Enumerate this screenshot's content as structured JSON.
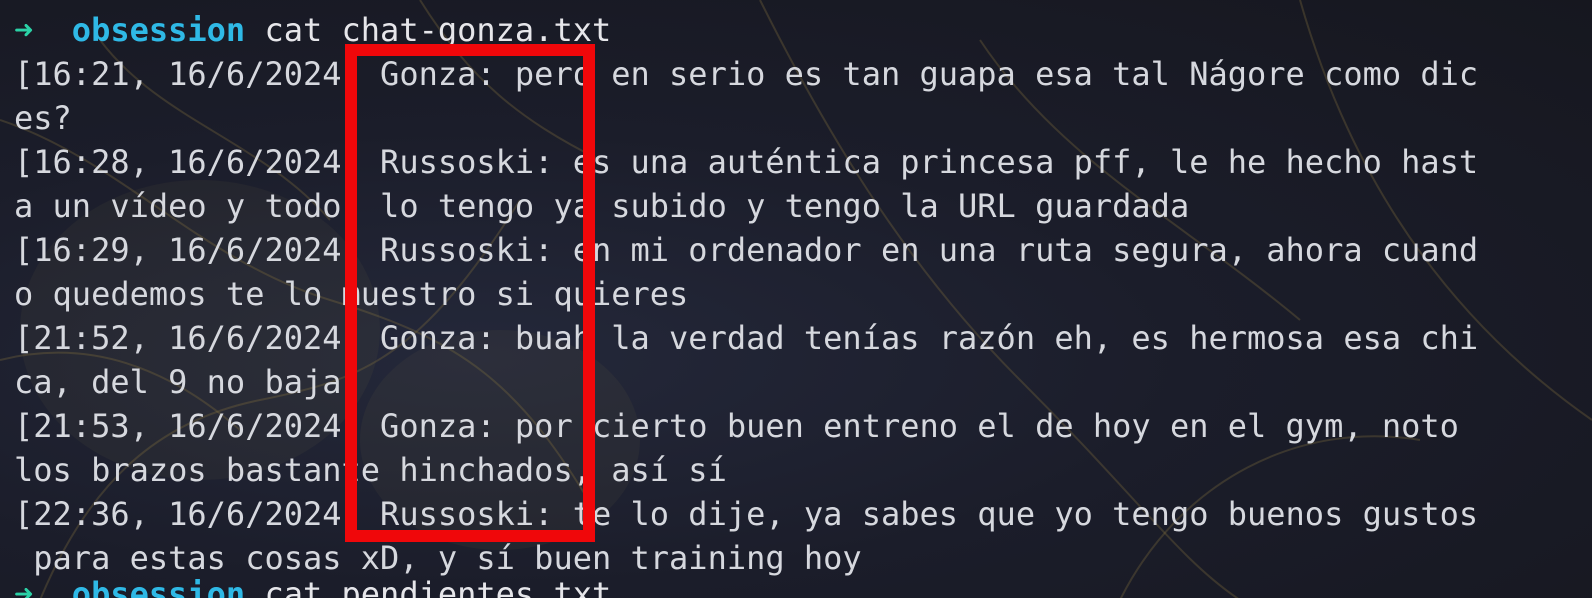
{
  "terminal": {
    "prompt_arrow": "➜",
    "prompt_dir": "obsession",
    "command": "cat chat-gonza.txt",
    "lines": [
      "[16:21, 16/6/2024] Gonza: pero en serio es tan guapa esa tal Nágore como dic",
      "es?",
      "[16:28, 16/6/2024] Russoski: es una auténtica princesa pff, le he hecho hast",
      "a un vídeo y todo, lo tengo ya subido y tengo la URL guardada",
      "[16:29, 16/6/2024] Russoski: en mi ordenador en una ruta segura, ahora cuand",
      "o quedemos te lo muestro si quieres",
      "[21:52, 16/6/2024] Gonza: buah la verdad tenías razón eh, es hermosa esa chi",
      "ca, del 9 no baja",
      "[21:53, 16/6/2024] Gonza: por cierto buen entreno el de hoy en el gym, noto ",
      "los brazos bastante hinchados, así sí",
      "[22:36, 16/6/2024] Russoski: te lo dije, ya sabes que yo tengo buenos gustos",
      " para estas cosas xD, y sí buen training hoy"
    ],
    "next_prompt_dir": "obsession",
    "next_command": "cat pendientes.txt"
  },
  "colors": {
    "highlight_box": "#f0070a",
    "prompt_arrow": "#2bd1a6",
    "prompt_dir": "#2fb9e6",
    "text": "#d6d8de"
  }
}
